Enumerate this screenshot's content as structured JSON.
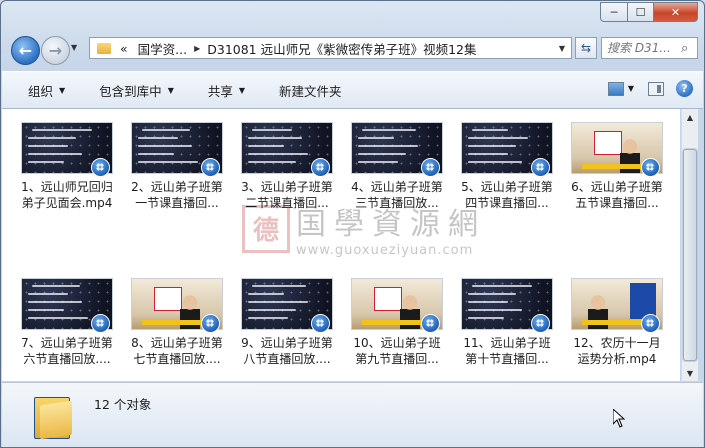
{
  "window": {
    "minimize": "─",
    "maximize": "☐",
    "close": "✕"
  },
  "nav": {
    "breadcrumb": [
      "«",
      "国学资...",
      "D31081 远山师兄《紫微密传弟子班》视频12集"
    ],
    "search_placeholder": "搜索 D31..."
  },
  "toolbar": {
    "items": [
      {
        "label": "组织",
        "caret": true
      },
      {
        "label": "包含到库中",
        "caret": true
      },
      {
        "label": "共享",
        "caret": true
      },
      {
        "label": "新建文件夹",
        "caret": false
      }
    ]
  },
  "watermark": {
    "seal": "德",
    "text": "国學資源網",
    "url": "www.guoxueziyuan.com"
  },
  "files": [
    {
      "line1": "1、远山师兄回归",
      "line2": "弟子见面会.mp4",
      "style": "dark"
    },
    {
      "line1": "2、远山弟子班第",
      "line2": "一节课直播回...",
      "style": "dark"
    },
    {
      "line1": "3、远山弟子班第",
      "line2": "二节课直播回...",
      "style": "dark"
    },
    {
      "line1": "4、远山弟子班第",
      "line2": "三节直播回放...",
      "style": "dark"
    },
    {
      "line1": "5、远山弟子班第",
      "line2": "四节课直播回...",
      "style": "dark"
    },
    {
      "line1": "6、远山弟子班第",
      "line2": "五节课直播回...",
      "style": "room"
    },
    {
      "line1": "7、远山弟子班第",
      "line2": "六节直播回放....",
      "style": "dark"
    },
    {
      "line1": "8、远山弟子班第",
      "line2": "七节直播回放....",
      "style": "room"
    },
    {
      "line1": "9、远山弟子班第",
      "line2": "八节直播回放....",
      "style": "dark"
    },
    {
      "line1": "10、远山弟子班",
      "line2": "第九节直播回...",
      "style": "room"
    },
    {
      "line1": "11、远山弟子班",
      "line2": "第十节直播回...",
      "style": "dark"
    },
    {
      "line1": "12、农历十一月",
      "line2": "运势分析.mp4",
      "style": "room"
    }
  ],
  "status": {
    "count": "12 个对象"
  }
}
